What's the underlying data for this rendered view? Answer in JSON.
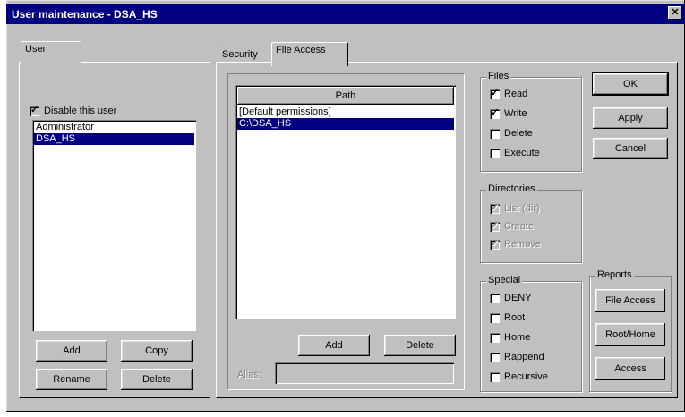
{
  "window": {
    "title": "User maintenance - DSA_HS",
    "close_glyph": "✕"
  },
  "user_tab": {
    "label": "User",
    "disable_checkbox_label": "Disable this user",
    "disable_checked": true,
    "list_items": [
      "Administrator",
      "DSA_HS"
    ],
    "selected_index": 1,
    "buttons": {
      "add": "Add",
      "copy": "Copy",
      "rename": "Rename",
      "delete": "Delete"
    }
  },
  "right_tabs": [
    {
      "label": "Security"
    },
    {
      "label": "File Access"
    }
  ],
  "file_access": {
    "path_header": "Path",
    "paths": [
      "[Default permissions]",
      "C:\\DSA_HS"
    ],
    "selected_index": 1,
    "buttons": {
      "add": "Add",
      "delete": "Delete"
    },
    "alias_label": "Alias:",
    "alias_value": ""
  },
  "files_group": {
    "label": "Files",
    "items": [
      {
        "label": "Read",
        "checked": true
      },
      {
        "label": "Write",
        "checked": true
      },
      {
        "label": "Delete",
        "checked": false
      },
      {
        "label": "Execute",
        "checked": false
      }
    ]
  },
  "dirs_group": {
    "label": "Directories",
    "items": [
      {
        "label": "List (dir)",
        "checked": true
      },
      {
        "label": "Create",
        "checked": true
      },
      {
        "label": "Remove",
        "checked": true
      }
    ]
  },
  "special_group": {
    "label": "Special",
    "items": [
      {
        "label": "DENY",
        "checked": false
      },
      {
        "label": "Root",
        "checked": false
      },
      {
        "label": "Home",
        "checked": false
      },
      {
        "label": "Rappend",
        "checked": false
      },
      {
        "label": "Recursive",
        "checked": false
      }
    ]
  },
  "dialog_buttons": {
    "ok": "OK",
    "apply": "Apply",
    "cancel": "Cancel"
  },
  "reports_group": {
    "label": "Reports",
    "buttons": {
      "file_access": "File Access",
      "root_home": "Root/Home",
      "access": "Access"
    }
  }
}
